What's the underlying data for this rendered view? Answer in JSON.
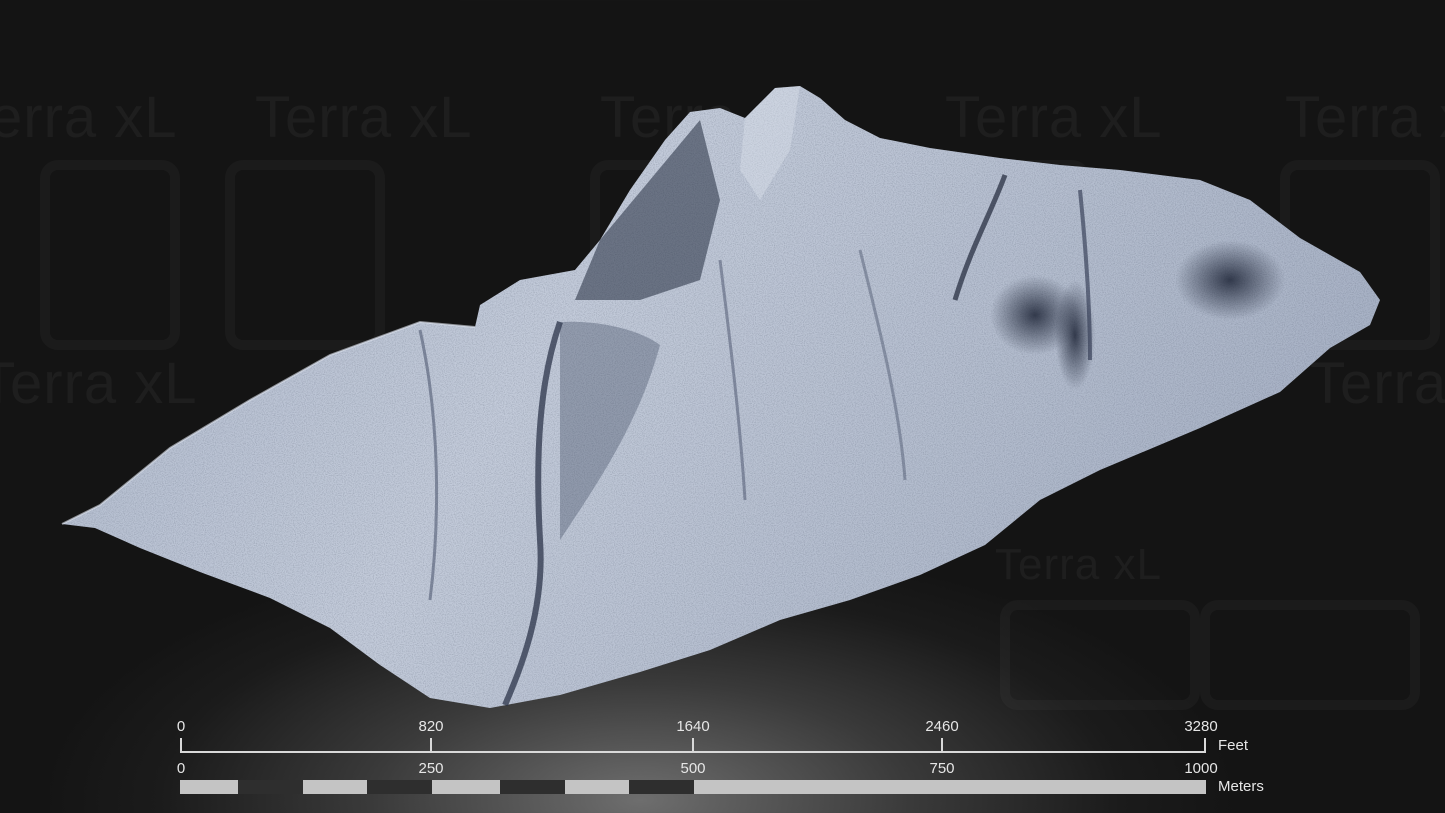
{
  "watermark": {
    "text": "Terra xL"
  },
  "scale_bar": {
    "feet": {
      "unit": "Feet",
      "ticks": [
        "0",
        "820",
        "1640",
        "2460",
        "3280"
      ]
    },
    "meters": {
      "unit": "Meters",
      "ticks": [
        "0",
        "250",
        "500",
        "750",
        "1000"
      ]
    }
  },
  "colors": {
    "terrain_light": "#b9c2d3",
    "terrain_shadow": "#2a3347",
    "background": "#1b1b1b"
  }
}
